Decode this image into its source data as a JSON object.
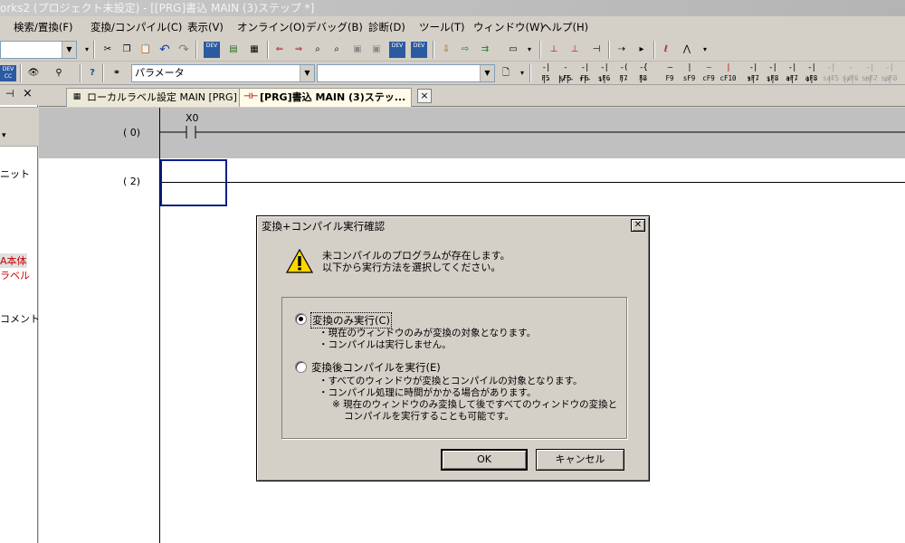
{
  "window": {
    "title": "orks2 (プロジェクト未設定) - [[PRG]書込 MAIN (3)ステップ *]"
  },
  "menu": [
    {
      "label": "検索/置換(F)"
    },
    {
      "label": "変換/コンパイル(C)"
    },
    {
      "label": "表示(V)"
    },
    {
      "label": "オンライン(O)"
    },
    {
      "label": "デバッグ(B)"
    },
    {
      "label": "診断(D)"
    },
    {
      "label": "ツール(T)"
    },
    {
      "label": "ウィンドウ(W)"
    },
    {
      "label": "ヘルプ(H)"
    }
  ],
  "toolbar2": {
    "parameter_combo": "パラメータ"
  },
  "function_keys": [
    {
      "label": "F5",
      "symbol": "-| |-",
      "enabled": true
    },
    {
      "label": "sF5",
      "symbol": "-|/|-",
      "enabled": true
    },
    {
      "label": "F6",
      "symbol": "-|↑|-",
      "enabled": true
    },
    {
      "label": "sF6",
      "symbol": "-|↓|-",
      "enabled": true
    },
    {
      "label": "F7",
      "symbol": "-( )-",
      "enabled": true
    },
    {
      "label": "F8",
      "symbol": "-{ }-",
      "enabled": true
    },
    {
      "label": "F9",
      "symbol": "—",
      "enabled": true
    },
    {
      "label": "sF9",
      "symbol": "|",
      "enabled": true
    },
    {
      "label": "cF9",
      "symbol": "—",
      "enabled": true
    },
    {
      "label": "cF10",
      "symbol": "|",
      "enabled": true
    },
    {
      "label": "sF7",
      "symbol": "-|↑|-",
      "enabled": true
    },
    {
      "label": "sF8",
      "symbol": "-|↓|-",
      "enabled": true
    },
    {
      "label": "aF7",
      "symbol": "-|↑|-",
      "enabled": true
    },
    {
      "label": "aF8",
      "symbol": "-|↓|-",
      "enabled": true
    },
    {
      "label": "saF5",
      "symbol": "-| |-",
      "enabled": false
    },
    {
      "label": "saF6",
      "symbol": "-|/|-",
      "enabled": false
    },
    {
      "label": "saF7",
      "symbol": "-|↑|-",
      "enabled": false
    },
    {
      "label": "saF8",
      "symbol": "-|↓|-",
      "enabled": false
    }
  ],
  "left_pane": {
    "items": [
      {
        "label": "ニット",
        "color": "#000000"
      },
      {
        "label": "A本体",
        "color": "#cc0000"
      },
      {
        "label": "ラベル",
        "color": "#cc0000"
      },
      {
        "label": "コメント",
        "color": "#000000"
      }
    ]
  },
  "tabs": [
    {
      "label": "ローカルラベル設定 MAIN [PRG]",
      "active": false
    },
    {
      "label": "[PRG]書込 MAIN (3)ステッ...",
      "active": true
    }
  ],
  "ladder": {
    "steps": [
      {
        "number": "(    0)",
        "device": "X0"
      },
      {
        "number": "(    2)",
        "device": ""
      }
    ]
  },
  "dialog": {
    "title": "変換+コンパイル実行確認",
    "message_line1": "未コンパイルのプログラムが存在します。",
    "message_line2": "以下から実行方法を選択してください。",
    "option1": {
      "label": "変換のみ実行(C)",
      "selected": true,
      "desc": [
        "・現在のウィンドウのみが変換の対象となります。",
        "・コンパイルは実行しません。"
      ]
    },
    "option2": {
      "label": "変換後コンパイルを実行(E)",
      "selected": false,
      "desc": [
        "・すべてのウィンドウが変換とコンパイルの対象となります。",
        "・コンパイル処理に時間がかかる場合があります。",
        "※ 現在のウィンドウのみ変換して後ですべてのウィンドウの変換と",
        "コンパイルを実行することも可能です。"
      ]
    },
    "ok_label": "OK",
    "cancel_label": "キャンセル"
  }
}
